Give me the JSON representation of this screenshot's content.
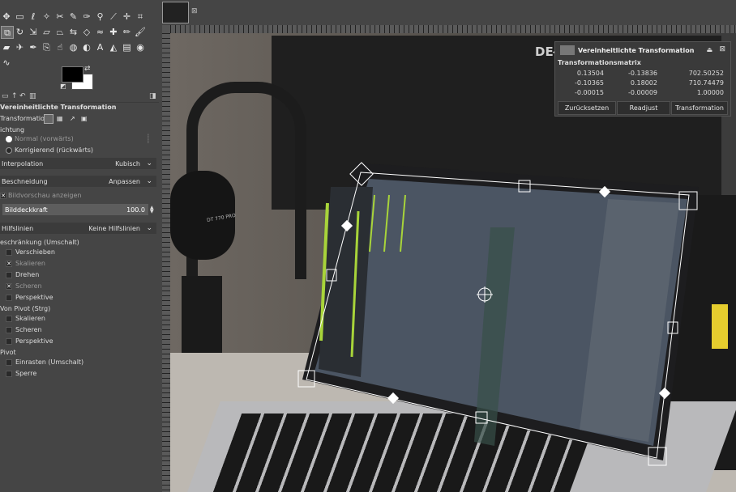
{
  "toolbox": {
    "tools": [
      "move-icon",
      "rect-select-icon",
      "lasso-icon",
      "fuzzy-select-icon",
      "scissors-select-icon",
      "paths-icon",
      "color-picker-icon",
      "zoom-icon",
      "measure-icon",
      "align-icon",
      "crop-icon",
      "unified-transform-icon",
      "rotate-icon",
      "scale-icon",
      "shear-icon",
      "perspective-icon",
      "flip-icon",
      "cage-icon",
      "warp-icon",
      "heal-icon",
      "pencil-icon",
      "paintbrush-icon",
      "eraser-icon",
      "airbrush-icon",
      "ink-icon",
      "clone-icon",
      "smudge-icon",
      "blur-icon",
      "dodge-icon",
      "text-icon",
      "bucket-fill-icon",
      "gradient-icon",
      "foreground-select-icon",
      "warp-transform-icon"
    ],
    "fg_color": "#000000",
    "bg_color": "#ffffff"
  },
  "options": {
    "title": "Vereinheitlichte Transformation",
    "transform_label": "Transformation:",
    "direction_label": "ichtung",
    "direction_normal": "Normal (vorwärts)",
    "direction_corrective": "Korrigierend (rückwärts)",
    "interpolation_label": "Interpolation",
    "interpolation_value": "Kubisch",
    "clipping_label": "Beschneidung",
    "clipping_value": "Anpassen",
    "show_preview": "Bildvorschau anzeigen",
    "opacity_label": "Bilddeckkraft",
    "opacity_value": "100.0",
    "guides_label": "Hilfslinien",
    "guides_value": "Keine Hilfslinien",
    "constrain_label": "eschränkung (Umschalt)",
    "constrain_items": [
      "Verschieben",
      "Skalieren",
      "Drehen",
      "Scheren",
      "Perspektive"
    ],
    "pivot_label": "Von Pivot (Strg)",
    "pivot_items": [
      "Skalieren",
      "Scheren",
      "Perspektive"
    ],
    "pivot2_label": "Pivot",
    "pivot2_items": [
      "Einrasten (Umschalt)",
      "Sperre"
    ]
  },
  "dialog": {
    "title": "Vereinheitlichte Transformation",
    "subtitle": "Transformationsmatrix",
    "matrix": [
      [
        "0.13504",
        "-0.13836",
        "702.50252"
      ],
      [
        "-0.10365",
        "0.18002",
        "710.74479"
      ],
      [
        "-0.00015",
        "-0.00009",
        "1.00000"
      ]
    ],
    "buttons": [
      "Zurücksetzen",
      "Readjust",
      "Transformation"
    ]
  },
  "photo": {
    "monitor_brand": "DEŁT",
    "headphone_text": "DT 770 PRO"
  }
}
